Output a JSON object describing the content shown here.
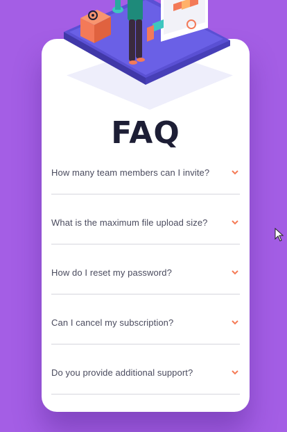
{
  "page": {
    "title": "FAQ"
  },
  "faq": {
    "items": [
      {
        "question": "How many team members can I invite?"
      },
      {
        "question": "What is the maximum file upload size?"
      },
      {
        "question": "How do I reset my password?"
      },
      {
        "question": "Can I cancel my subscription?"
      },
      {
        "question": "Do you provide additional support?"
      }
    ]
  },
  "colors": {
    "background": "#a45ee5",
    "card": "#ffffff",
    "title": "#1d1e35",
    "question_text": "#4a4b5e",
    "chevron": "#f47b56",
    "divider": "#d5d5dd",
    "platform": "#5a50d4",
    "box": "#f37a58"
  },
  "icons": {
    "chevron": "chevron-down-icon",
    "cursor": "mouse-pointer-icon",
    "illustration": "woman-online-illustration"
  }
}
